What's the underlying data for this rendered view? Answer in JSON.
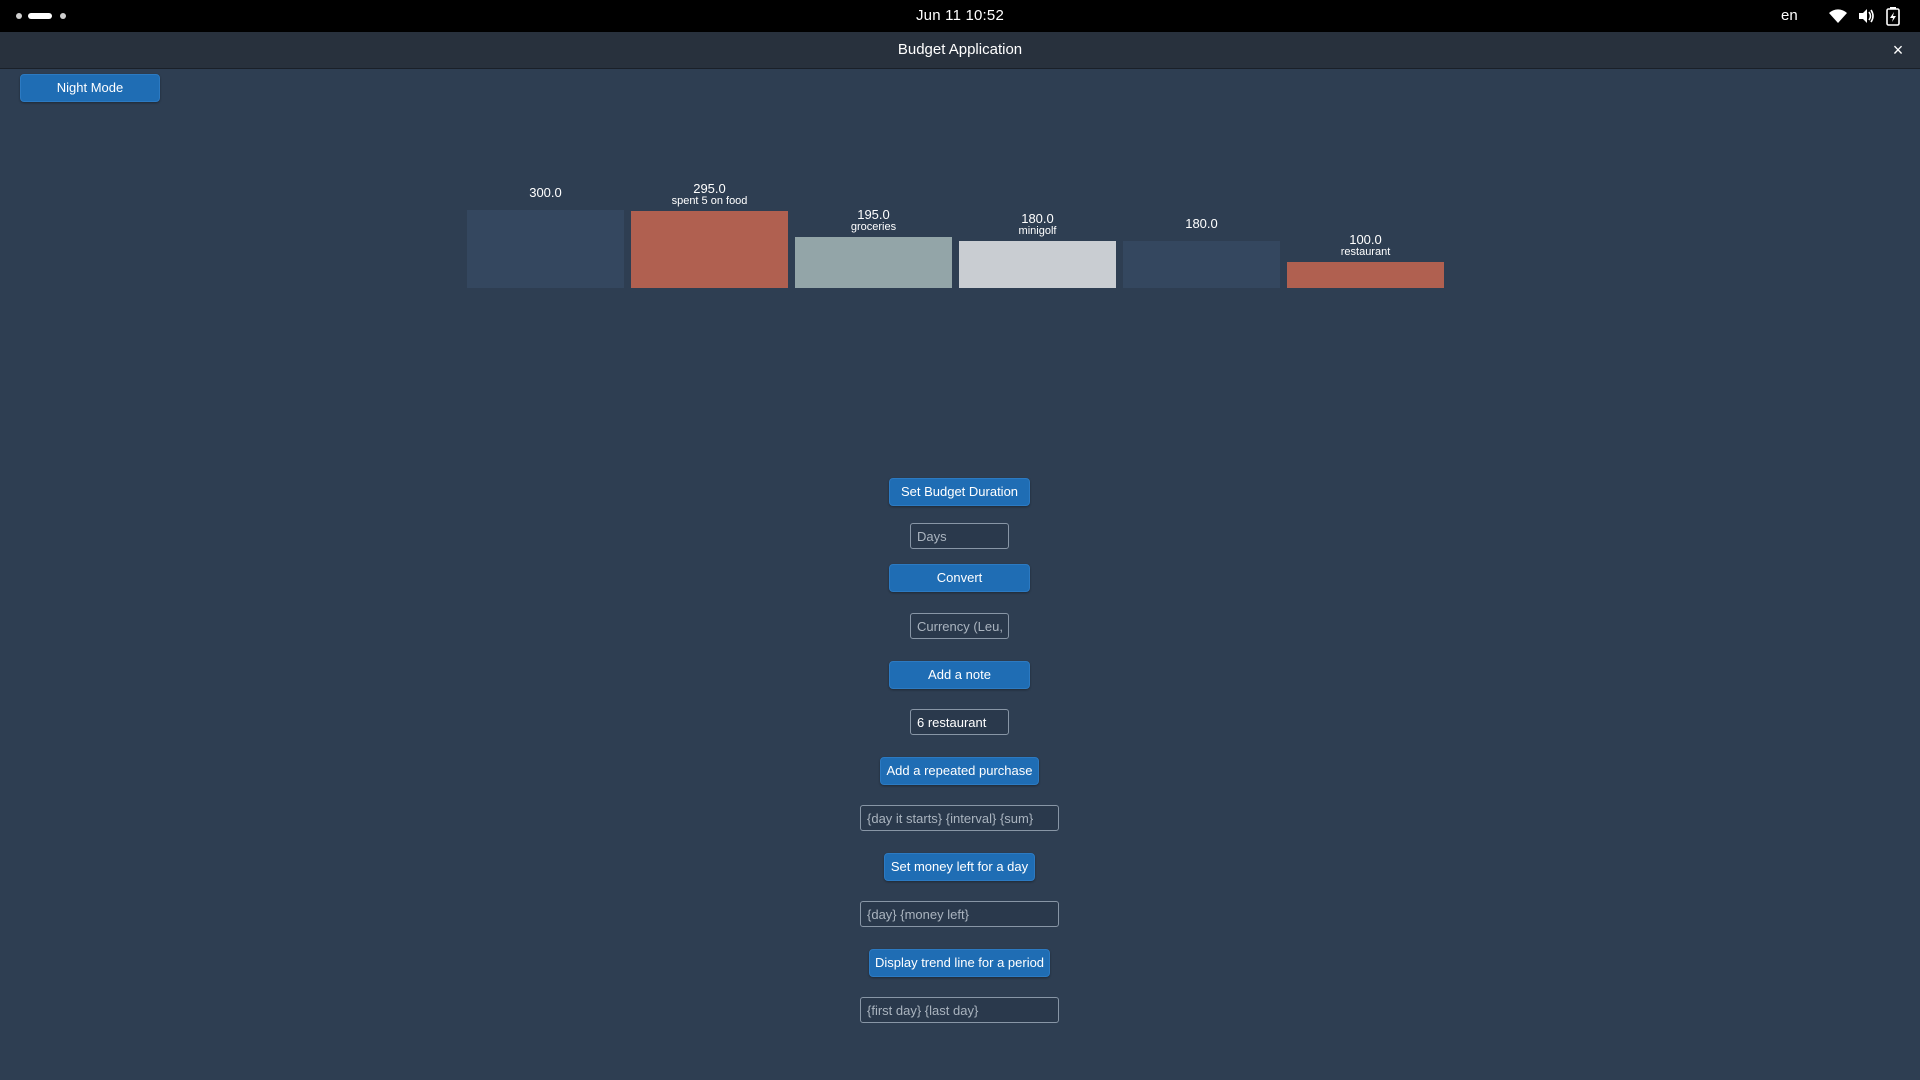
{
  "topbar": {
    "clock": "Jun 11  10:52",
    "language": "en",
    "icons": [
      "workspace-indicator",
      "wifi-icon",
      "volume-icon",
      "battery-icon"
    ]
  },
  "window": {
    "title": "Budget Application",
    "close_label": "×"
  },
  "night_mode_label": "Night Mode",
  "chart_data": {
    "type": "bar",
    "values": [
      300.0,
      295.0,
      195.0,
      180.0,
      180.0,
      100.0
    ],
    "value_labels": [
      "300.0",
      "295.0",
      "195.0",
      "180.0",
      "180.0",
      "100.0"
    ],
    "notes": [
      "",
      "spent 5 on food",
      "groceries",
      "minigolf",
      "",
      "restaurant"
    ],
    "colors": [
      "#34475f",
      "#b06050",
      "#93a5a8",
      "#c9cdd2",
      "#34475f",
      "#b06050"
    ],
    "ylim": [
      0,
      300
    ]
  },
  "controls": {
    "set_duration_label": "Set Budget Duration",
    "days_placeholder": "Days",
    "convert_label": "Convert",
    "currency_placeholder": "Currency (Leu,",
    "add_note_label": "Add a note",
    "note_value": "6 restaurant",
    "repeated_label": "Add a repeated purchase",
    "repeated_placeholder": "{day it starts} {interval} {sum}",
    "money_left_label": "Set money left for a day",
    "money_left_placeholder": "{day} {money left}",
    "trend_label": "Display trend line for a period",
    "trend_placeholder": "{first day} {last day}"
  }
}
